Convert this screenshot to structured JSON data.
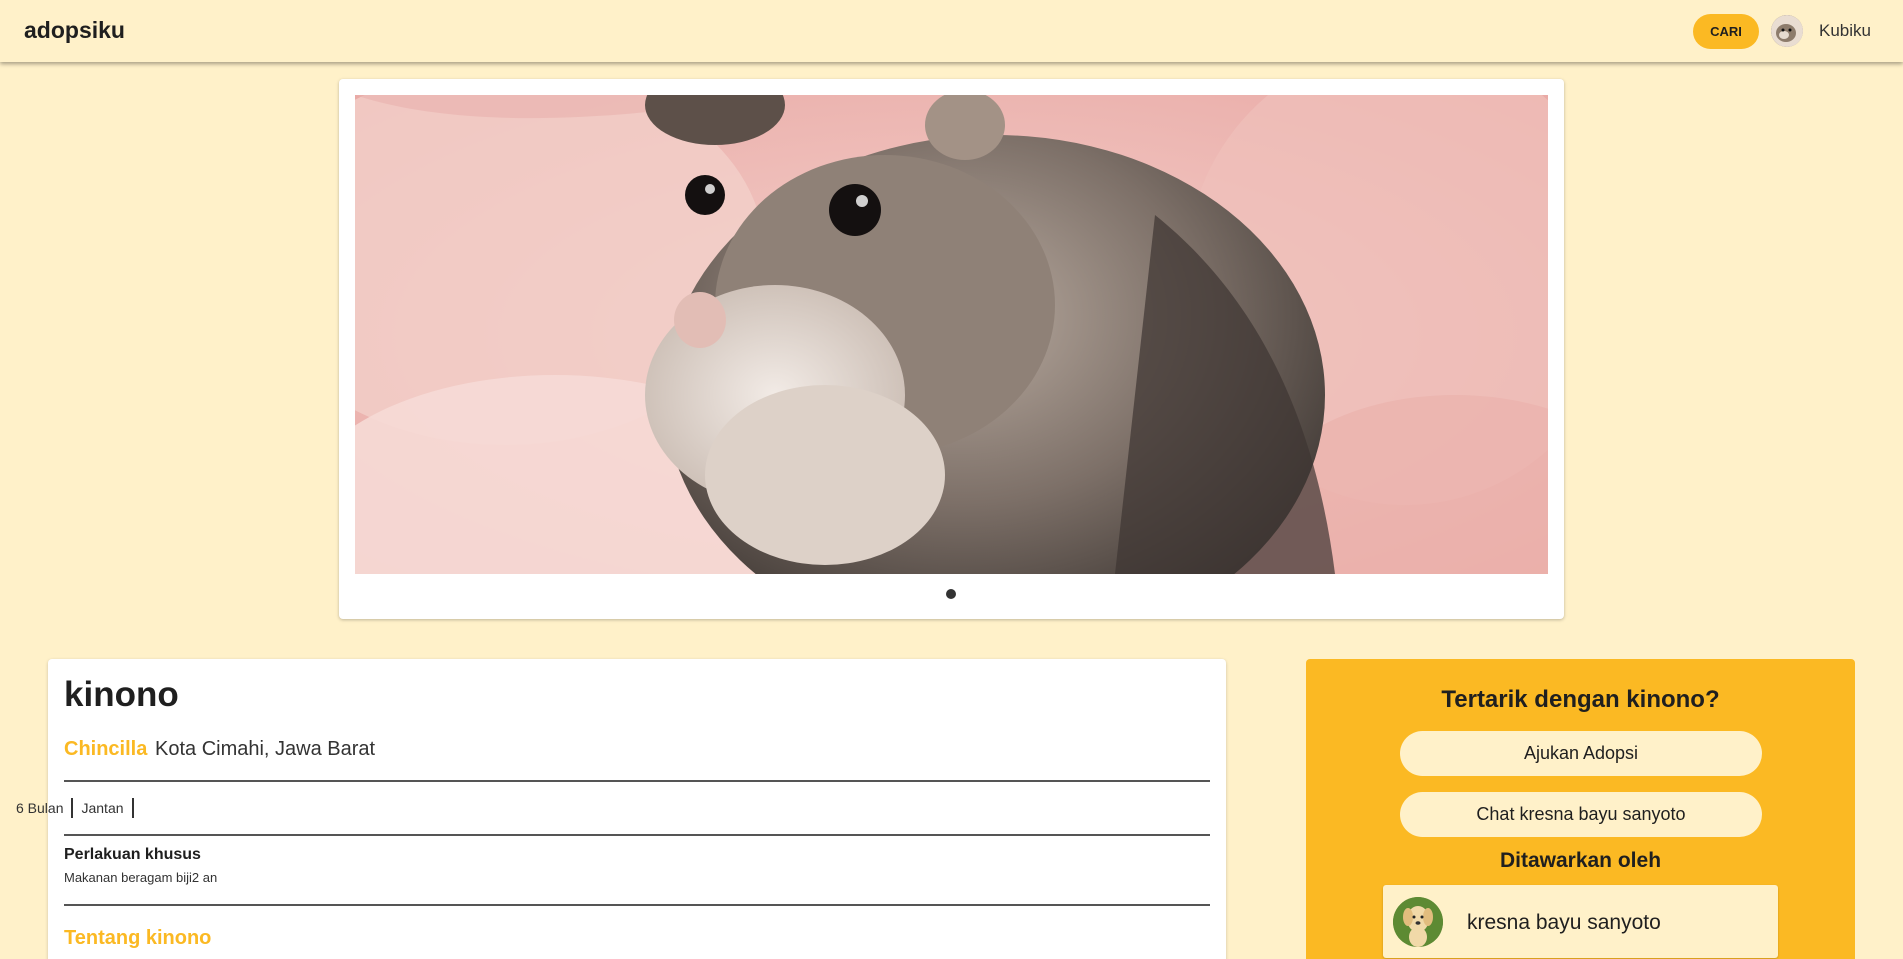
{
  "header": {
    "brand": "adopsiku",
    "search_button": "CARI",
    "user_name": "Kubiku"
  },
  "carousel": {
    "image_subject": "hamster",
    "active_slide": 1,
    "slide_count": 1
  },
  "pet": {
    "name": "kinono",
    "breed": "Chincilla",
    "location": "Kota Cimahi, Jawa Barat",
    "attributes": [
      "6 Bulan",
      "Jantan",
      ""
    ],
    "special_title": "Perlakuan khusus",
    "special_text": "Makanan beragam biji2 an",
    "about_title": "Tentang kinono"
  },
  "side_panel": {
    "title": "Tertarik dengan kinono?",
    "adopt_button": "Ajukan Adopsi",
    "chat_button": "Chat kresna bayu sanyoto",
    "offered_by": "Ditawarkan oleh",
    "owner_name": "kresna bayu sanyoto"
  },
  "colors": {
    "background": "#fff1c9",
    "accent": "#fbb923",
    "card": "#ffffff",
    "text": "#1f1f1f"
  }
}
